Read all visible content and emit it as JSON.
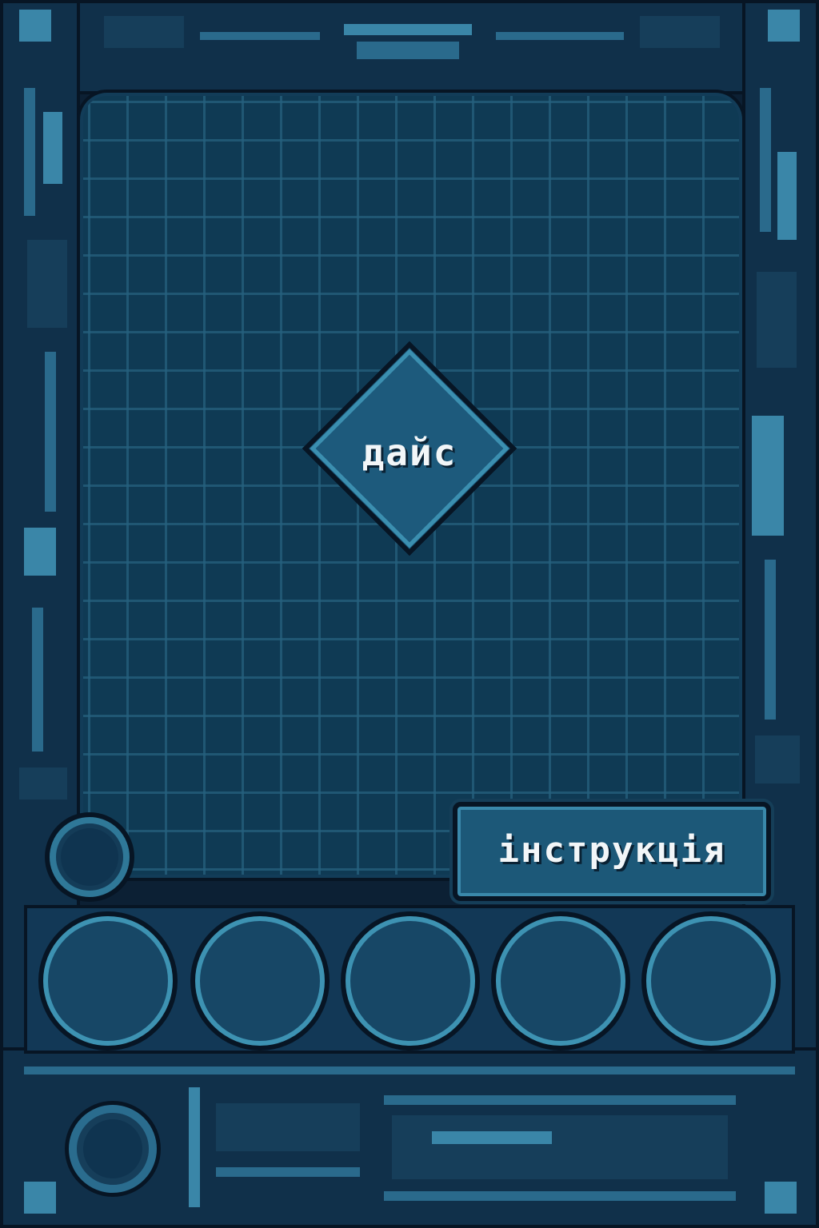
{
  "board": {
    "dice_label": "дайс",
    "instruction_label": "інструкція"
  },
  "slots": {
    "count": 5
  },
  "palette": {
    "background": "#0c2034",
    "board": "#0f3a54",
    "grid_line": "#26607e",
    "accent": "#3b8fb0",
    "button_fill": "#1c5878",
    "text": "#f2f6f8"
  }
}
